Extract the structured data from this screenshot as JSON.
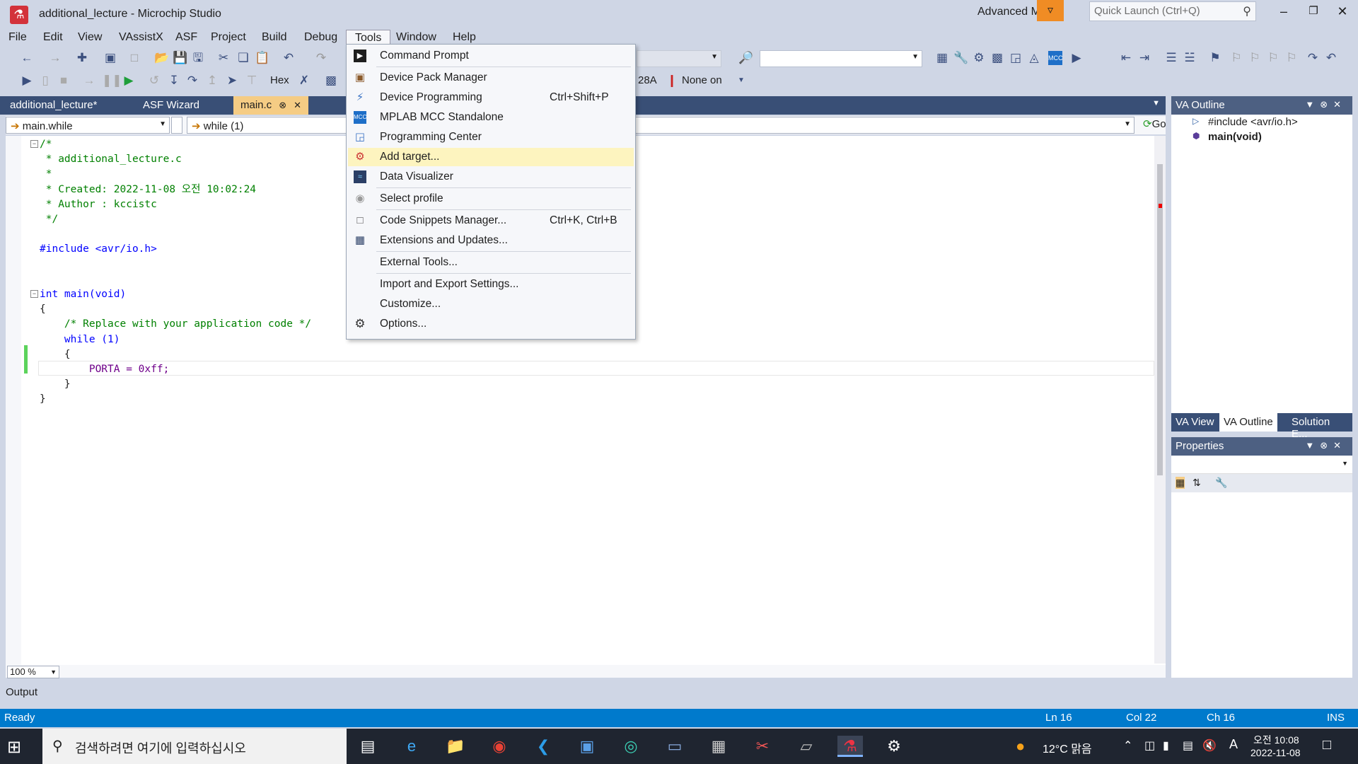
{
  "window": {
    "title": "additional_lecture - Microchip Studio",
    "advanced_mode": "Advanced Mode",
    "quick_launch_placeholder": "Quick Launch (Ctrl+Q)"
  },
  "menu": [
    "File",
    "Edit",
    "View",
    "VAssistX",
    "ASF",
    "Project",
    "Build",
    "Debug",
    "Tools",
    "Window",
    "Help"
  ],
  "toolbar": {
    "hex_label": "Hex",
    "device_suffix": "28A",
    "none_on_label": "None on"
  },
  "tabs": {
    "project": "additional_lecture*",
    "asf": "ASF Wizard",
    "active": "main.c"
  },
  "nav": {
    "scope": "main.while",
    "member": "while (1)",
    "go": "Go"
  },
  "editor": {
    "lines": [
      "/*",
      " * additional_lecture.c",
      " *",
      " * Created: 2022-11-08 오전 10:02:24",
      " * Author : kccistc",
      " */",
      "",
      "#include <avr/io.h>",
      "",
      "",
      "int main(void)",
      "{",
      "    /* Replace with your application code */",
      "    while (1)",
      "    {",
      "        PORTA = 0xff;",
      "    }",
      "}"
    ],
    "zoom": "100 %"
  },
  "tools_menu": [
    {
      "label": "Command Prompt",
      "shortcut": "",
      "icon": "terminal-icon"
    },
    {
      "label": "Device Pack Manager",
      "shortcut": "",
      "icon": "package-icon"
    },
    {
      "label": "Device Programming",
      "shortcut": "Ctrl+Shift+P",
      "icon": "chip-program-icon"
    },
    {
      "label": "MPLAB MCC Standalone",
      "shortcut": "",
      "icon": "mcc-icon"
    },
    {
      "label": "Programming Center",
      "shortcut": "",
      "icon": "programming-center-icon"
    },
    {
      "label": "Add target...",
      "shortcut": "",
      "icon": "add-target-icon"
    },
    {
      "label": "Data Visualizer",
      "shortcut": "",
      "icon": "data-visualizer-icon"
    },
    {
      "label": "Select profile",
      "shortcut": "",
      "icon": "profile-icon"
    },
    {
      "label": "Code Snippets Manager...",
      "shortcut": "Ctrl+K, Ctrl+B",
      "icon": "snippet-icon"
    },
    {
      "label": "Extensions and Updates...",
      "shortcut": "",
      "icon": "extensions-icon"
    },
    {
      "label": "External Tools...",
      "shortcut": "",
      "icon": ""
    },
    {
      "label": "Import and Export Settings...",
      "shortcut": "",
      "icon": ""
    },
    {
      "label": "Customize...",
      "shortcut": "",
      "icon": ""
    },
    {
      "label": "Options...",
      "shortcut": "",
      "icon": "gear-icon"
    }
  ],
  "va_outline": {
    "title": "VA Outline",
    "items": [
      "#include <avr/io.h>",
      "main(void)"
    ],
    "tabs": [
      "VA View",
      "VA Outline",
      "Solution E..."
    ]
  },
  "properties": {
    "title": "Properties"
  },
  "output": {
    "title": "Output"
  },
  "status": {
    "state": "Ready",
    "ln": "Ln 16",
    "col": "Col 22",
    "ch": "Ch 16",
    "mode": "INS"
  },
  "taskbar": {
    "search_placeholder": "검색하려면 여기에 입력하십시오",
    "weather": "12°C 맑음",
    "time": "오전 10:08",
    "date": "2022-11-08"
  },
  "colors": {
    "accent_tab": "#f5cc84",
    "status_bar": "#007acc",
    "menu_highlight": "#fdf4bf"
  }
}
